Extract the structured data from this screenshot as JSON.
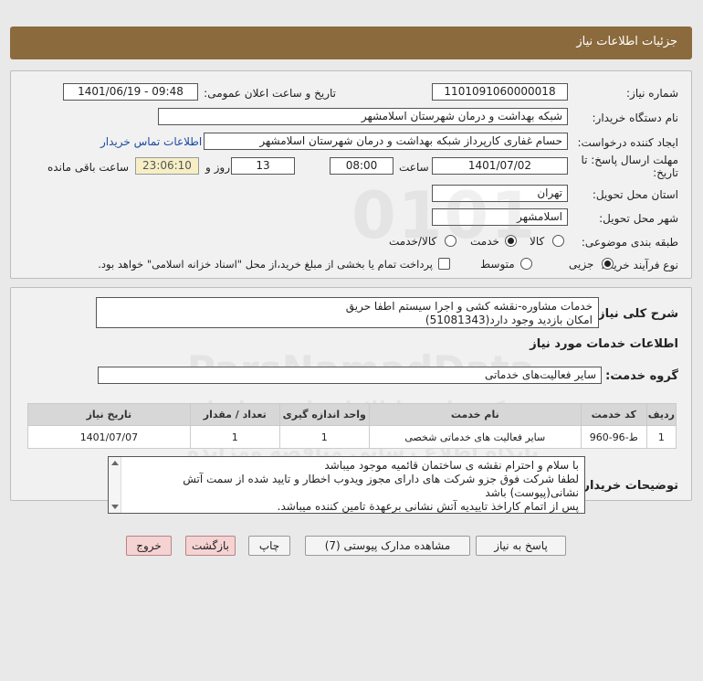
{
  "header": {
    "title": "جزئیات اطلاعات نیاز"
  },
  "form": {
    "need_number": {
      "label": "شماره نیاز:",
      "value": "1101091060000018"
    },
    "announce_datetime": {
      "label": "تاریخ و ساعت اعلان عمومی:",
      "value": "1401/06/19 - 09:48"
    },
    "buyer_org": {
      "label": "نام دستگاه خریدار:",
      "value": "شبکه بهداشت و درمان شهرستان اسلامشهر"
    },
    "requester": {
      "label": "ایجاد کننده درخواست:",
      "value": "حسام غفاری کارپرداز شبکه بهداشت و درمان شهرستان اسلامشهر"
    },
    "contact_link": "اطلاعات تماس خریدار",
    "deadline": {
      "label_line1": "مهلت ارسال پاسخ: تا",
      "label_line2": "تاریخ:",
      "date": "1401/07/02",
      "time_label": "ساعت",
      "time": "08:00",
      "days": "13",
      "days_label": "روز و",
      "remaining": "23:06:10",
      "remaining_label": "ساعت باقی مانده"
    },
    "delivery_province": {
      "label": "استان محل تحویل:",
      "value": "تهران"
    },
    "delivery_city": {
      "label": "شهر محل تحویل:",
      "value": "اسلامشهر"
    },
    "category": {
      "label": "طبقه بندی موضوعی:",
      "options": [
        "کالا",
        "خدمت",
        "کالا/خدمت"
      ],
      "selected": "خدمت"
    },
    "purchase_process": {
      "label": "نوع فرآیند خرید :",
      "options": [
        "جزیی",
        "متوسط"
      ],
      "selected": "جزیی",
      "treasury_note": "پرداخت تمام یا بخشی از مبلغ خرید،از محل \"اسناد خزانه اسلامی\" خواهد بود."
    }
  },
  "details": {
    "general_desc_label": "شرح کلی نیاز:",
    "general_desc_lines": [
      "خدمات مشاوره-نقشه کشی و اجرا سیستم اطفا حریق",
      "امکان بازدید وجود دارد(51081343)"
    ],
    "services_section_title": "اطلاعات خدمات مورد نیاز",
    "service_group_label": "گروه خدمت:",
    "service_group_value": "سایر فعالیت‌های خدماتی",
    "table": {
      "headers": [
        "ردیف",
        "کد خدمت",
        "نام خدمت",
        "واحد اندازه گیری",
        "تعداد / مقدار",
        "تاریخ نیاز"
      ],
      "rows": [
        [
          "1",
          "ط-96-960",
          "سایر فعالیت های خدماتی شخصی",
          "1",
          "1",
          "1401/07/07"
        ]
      ]
    },
    "buyer_notes_label": "توضیحات خریدار:",
    "buyer_notes_lines": [
      "با سلام و احترام نقشه ی ساختمان قائمیه موجود میباشد",
      "لطفا شرکت فوق جزو شرکت های دارای مجوز ویدوب اخطار و تایید شده از سمت آتش",
      "نشانی(پیوست) باشد",
      "پس از اتمام کاراخذ تاییدیه آتش نشانی برعهدة تامین کننده میباشد."
    ]
  },
  "buttons": {
    "reply": "پاسخ به نیاز",
    "attachments": "مشاهده مدارک پیوستی (7)",
    "print": "چاپ",
    "back": "بازگشت",
    "exit": "خروج"
  },
  "watermark": {
    "brand": "ParsNamadData",
    "tagline": "مرکز فراوری اطلاعات پارس نماد داده",
    "sub": "پایگاه اطلاع رسانی مناقصه ومزایده"
  }
}
